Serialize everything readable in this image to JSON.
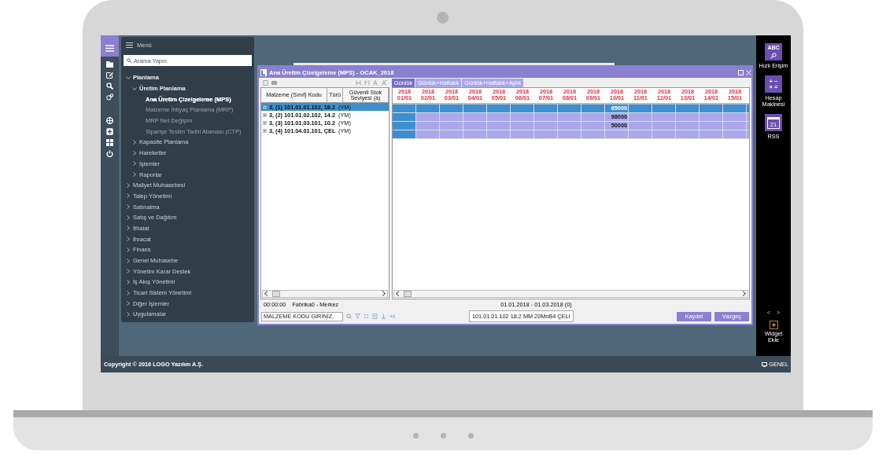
{
  "menu": {
    "title": "Menü",
    "search": {
      "placeholder": "Arama Yapın"
    },
    "items": [
      {
        "label": "Planlama",
        "expanded": true,
        "selected": false,
        "children": [
          {
            "label": "Üretim Planlama",
            "expanded": true,
            "selected": false,
            "children": [
              {
                "label": "Ana Üretim Çizelgeleme (MPS)",
                "selected": true
              },
              {
                "label": "Malzeme İhtiyaç Planlama (MRP)",
                "selected": false
              },
              {
                "label": "MRP Net Değişim",
                "selected": false
              },
              {
                "label": "Siparişe Teslim Tarihi Ataması (CTP)",
                "selected": false
              }
            ]
          },
          {
            "label": "Kapasite Planlama",
            "expanded": false,
            "selected": false
          },
          {
            "label": "Hareketler",
            "expanded": false,
            "selected": false
          },
          {
            "label": "İşlemler",
            "expanded": false,
            "selected": false
          },
          {
            "label": "Raporlar",
            "expanded": false,
            "selected": false
          }
        ]
      },
      {
        "label": "Maliyet Muhasebesi",
        "expanded": false,
        "selected": false
      },
      {
        "label": "Talep Yönetimi",
        "expanded": false,
        "selected": false
      },
      {
        "label": "Satınalma",
        "expanded": false,
        "selected": false
      },
      {
        "label": "Satış ve Dağıtım",
        "expanded": false,
        "selected": false
      },
      {
        "label": "İthalat",
        "expanded": false,
        "selected": false
      },
      {
        "label": "İhracat",
        "expanded": false,
        "selected": false
      },
      {
        "label": "Finans",
        "expanded": false,
        "selected": false
      },
      {
        "label": "Genel Muhasebe",
        "expanded": false,
        "selected": false
      },
      {
        "label": "Yönetim Karar Destek",
        "expanded": false,
        "selected": false
      },
      {
        "label": "İş Akış Yönetimi",
        "expanded": false,
        "selected": false
      },
      {
        "label": "Ticari Sistem Yönetimi",
        "expanded": false,
        "selected": false
      },
      {
        "label": "Diğer İşlemler",
        "expanded": false,
        "selected": false
      },
      {
        "label": "Uygulamalar",
        "expanded": false,
        "selected": false
      }
    ]
  },
  "window": {
    "title": "Ana Üretim Çizelgeleme (MPS) - OCAK_2018",
    "table": {
      "columns": [
        "Malzeme (Sınıf) Kodu",
        "Türü",
        "Güvenli Stok Seviyesi (à)"
      ],
      "rows": [
        {
          "code": "3, (1) 101.01.01.102, 18.2",
          "type": "(YM)",
          "selected": true,
          "expanded": false
        },
        {
          "code": "3, (2) 101.01.02.102, 14.2",
          "type": "(YM)",
          "selected": false,
          "expanded": false
        },
        {
          "code": "3, (3) 101.01.03.101, 10.2",
          "type": "(YM)",
          "selected": false,
          "expanded": false
        },
        {
          "code": "3, (4) 101.04.01.101, ÇEL",
          "type": "(YM)",
          "selected": false,
          "expanded": false
        }
      ]
    },
    "tabs": [
      {
        "label": "Günlük",
        "selected": true
      },
      {
        "label": "Günlük+Haftalık",
        "selected": false
      },
      {
        "label": "Günlük+Haftalık+Aylık",
        "selected": false
      }
    ],
    "grid": {
      "columns": [
        {
          "year": "2018",
          "day": "01/01"
        },
        {
          "year": "2018",
          "day": "02/01"
        },
        {
          "year": "2018",
          "day": "03/01"
        },
        {
          "year": "2018",
          "day": "04/01"
        },
        {
          "year": "2018",
          "day": "05/01"
        },
        {
          "year": "2018",
          "day": "06/01"
        },
        {
          "year": "2018",
          "day": "07/01"
        },
        {
          "year": "2018",
          "day": "08/01"
        },
        {
          "year": "2018",
          "day": "09/01"
        },
        {
          "year": "2018",
          "day": "10/01"
        },
        {
          "year": "2018",
          "day": "11/01"
        },
        {
          "year": "2018",
          "day": "12/01"
        },
        {
          "year": "2018",
          "day": "13/01"
        },
        {
          "year": "2018",
          "day": "14/01"
        },
        {
          "year": "2018",
          "day": "15/01"
        }
      ],
      "rows": [
        {
          "selected": true,
          "cells": [
            {
              "kind": "current"
            },
            {
              "kind": "blank"
            },
            {
              "kind": "blank"
            },
            {
              "kind": "blank"
            },
            {
              "kind": "blank"
            },
            {
              "kind": "blank"
            },
            {
              "kind": "blank"
            },
            {
              "kind": "blank"
            },
            {
              "kind": "blank"
            },
            {
              "kind": "value",
              "text": "65000"
            },
            {
              "kind": "blank"
            },
            {
              "kind": "blank"
            },
            {
              "kind": "blank"
            },
            {
              "kind": "blank"
            },
            {
              "kind": "blank"
            }
          ]
        },
        {
          "selected": false,
          "cells": [
            {
              "kind": "current"
            },
            {
              "kind": "blank"
            },
            {
              "kind": "blank"
            },
            {
              "kind": "blank"
            },
            {
              "kind": "blank"
            },
            {
              "kind": "blank"
            },
            {
              "kind": "blank"
            },
            {
              "kind": "blank"
            },
            {
              "kind": "blank"
            },
            {
              "kind": "value",
              "text": "98000"
            },
            {
              "kind": "blank"
            },
            {
              "kind": "blank"
            },
            {
              "kind": "blank"
            },
            {
              "kind": "blank"
            },
            {
              "kind": "blank"
            }
          ]
        },
        {
          "selected": false,
          "cells": [
            {
              "kind": "current"
            },
            {
              "kind": "blank"
            },
            {
              "kind": "blank"
            },
            {
              "kind": "blank"
            },
            {
              "kind": "blank"
            },
            {
              "kind": "blank"
            },
            {
              "kind": "blank"
            },
            {
              "kind": "blank"
            },
            {
              "kind": "blank"
            },
            {
              "kind": "value",
              "text": "50000"
            },
            {
              "kind": "blank"
            },
            {
              "kind": "blank"
            },
            {
              "kind": "blank"
            },
            {
              "kind": "blank"
            },
            {
              "kind": "blank"
            }
          ]
        },
        {
          "selected": false,
          "cells": [
            {
              "kind": "current"
            },
            {
              "kind": "blank"
            },
            {
              "kind": "blank"
            },
            {
              "kind": "blank"
            },
            {
              "kind": "blank"
            },
            {
              "kind": "blank"
            },
            {
              "kind": "blank"
            },
            {
              "kind": "blank"
            },
            {
              "kind": "blank"
            },
            {
              "kind": "blank"
            },
            {
              "kind": "blank"
            },
            {
              "kind": "blank"
            },
            {
              "kind": "blank"
            },
            {
              "kind": "blank"
            },
            {
              "kind": "blank"
            }
          ]
        }
      ]
    },
    "status": {
      "time": "00:00:00",
      "location": "Fabrika0 - Merkez",
      "range": "01.01.2018 - 01.03.2018 (0)"
    },
    "code_field": {
      "placeholder": "MALZEME KODU GİRİNİZ."
    },
    "description": "101.01.01.102 18.2 MM 20MnB4 ÇELI",
    "buttons": [
      "Kaydet",
      "Vazgeç"
    ]
  },
  "widgets": {
    "items": [
      {
        "kind": "search",
        "label": "Hızlı Erişim",
        "glyph": "ABC"
      },
      {
        "kind": "calculator",
        "label": "Hesap Makinesi",
        "glyph": "+ −\n× ="
      },
      {
        "kind": "calendar",
        "label": "RSS",
        "glyph": "21"
      }
    ],
    "prev": "<",
    "next": ">",
    "add_label": "Widget Ekle"
  },
  "footer": {
    "copyright": "Copyright © 2016 LOGO Yazılım A.Ş.",
    "workspace": "GENEL"
  }
}
